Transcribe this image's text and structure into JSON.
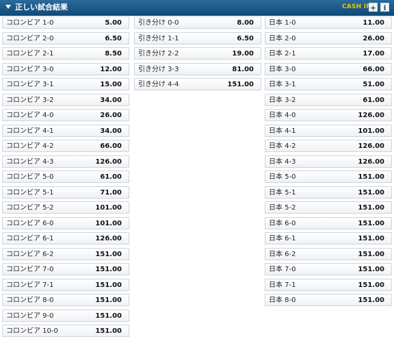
{
  "header": {
    "title": "正しい試合結果",
    "cashin_label": "CASH IN",
    "plus_label": "+",
    "info_label": "i",
    "accent_color": "#f2c200"
  },
  "columns": [
    {
      "name": "colombia",
      "rows": [
        {
          "label": "コロンビア 1-0",
          "odds": "5.00"
        },
        {
          "label": "コロンビア 2-0",
          "odds": "6.50"
        },
        {
          "label": "コロンビア 2-1",
          "odds": "8.50"
        },
        {
          "label": "コロンビア 3-0",
          "odds": "12.00"
        },
        {
          "label": "コロンビア 3-1",
          "odds": "15.00"
        },
        {
          "label": "コロンビア 3-2",
          "odds": "34.00"
        },
        {
          "label": "コロンビア 4-0",
          "odds": "26.00"
        },
        {
          "label": "コロンビア 4-1",
          "odds": "34.00"
        },
        {
          "label": "コロンビア 4-2",
          "odds": "66.00"
        },
        {
          "label": "コロンビア 4-3",
          "odds": "126.00"
        },
        {
          "label": "コロンビア 5-0",
          "odds": "61.00"
        },
        {
          "label": "コロンビア 5-1",
          "odds": "71.00"
        },
        {
          "label": "コロンビア 5-2",
          "odds": "101.00"
        },
        {
          "label": "コロンビア 6-0",
          "odds": "101.00"
        },
        {
          "label": "コロンビア 6-1",
          "odds": "126.00"
        },
        {
          "label": "コロンビア 6-2",
          "odds": "151.00"
        },
        {
          "label": "コロンビア 7-0",
          "odds": "151.00"
        },
        {
          "label": "コロンビア 7-1",
          "odds": "151.00"
        },
        {
          "label": "コロンビア 8-0",
          "odds": "151.00"
        },
        {
          "label": "コロンビア 9-0",
          "odds": "151.00"
        },
        {
          "label": "コロンビア 10-0",
          "odds": "151.00"
        }
      ]
    },
    {
      "name": "draw",
      "rows": [
        {
          "label": "引き分け 0-0",
          "odds": "8.00"
        },
        {
          "label": "引き分け 1-1",
          "odds": "6.50"
        },
        {
          "label": "引き分け 2-2",
          "odds": "19.00"
        },
        {
          "label": "引き分け 3-3",
          "odds": "81.00"
        },
        {
          "label": "引き分け 4-4",
          "odds": "151.00"
        }
      ]
    },
    {
      "name": "japan",
      "rows": [
        {
          "label": "日本 1-0",
          "odds": "11.00"
        },
        {
          "label": "日本 2-0",
          "odds": "26.00"
        },
        {
          "label": "日本 2-1",
          "odds": "17.00"
        },
        {
          "label": "日本 3-0",
          "odds": "66.00"
        },
        {
          "label": "日本 3-1",
          "odds": "51.00"
        },
        {
          "label": "日本 3-2",
          "odds": "61.00"
        },
        {
          "label": "日本 4-0",
          "odds": "126.00"
        },
        {
          "label": "日本 4-1",
          "odds": "101.00"
        },
        {
          "label": "日本 4-2",
          "odds": "126.00"
        },
        {
          "label": "日本 4-3",
          "odds": "126.00"
        },
        {
          "label": "日本 5-0",
          "odds": "151.00"
        },
        {
          "label": "日本 5-1",
          "odds": "151.00"
        },
        {
          "label": "日本 5-2",
          "odds": "151.00"
        },
        {
          "label": "日本 6-0",
          "odds": "151.00"
        },
        {
          "label": "日本 6-1",
          "odds": "151.00"
        },
        {
          "label": "日本 6-2",
          "odds": "151.00"
        },
        {
          "label": "日本 7-0",
          "odds": "151.00"
        },
        {
          "label": "日本 7-1",
          "odds": "151.00"
        },
        {
          "label": "日本 8-0",
          "odds": "151.00"
        }
      ]
    }
  ]
}
